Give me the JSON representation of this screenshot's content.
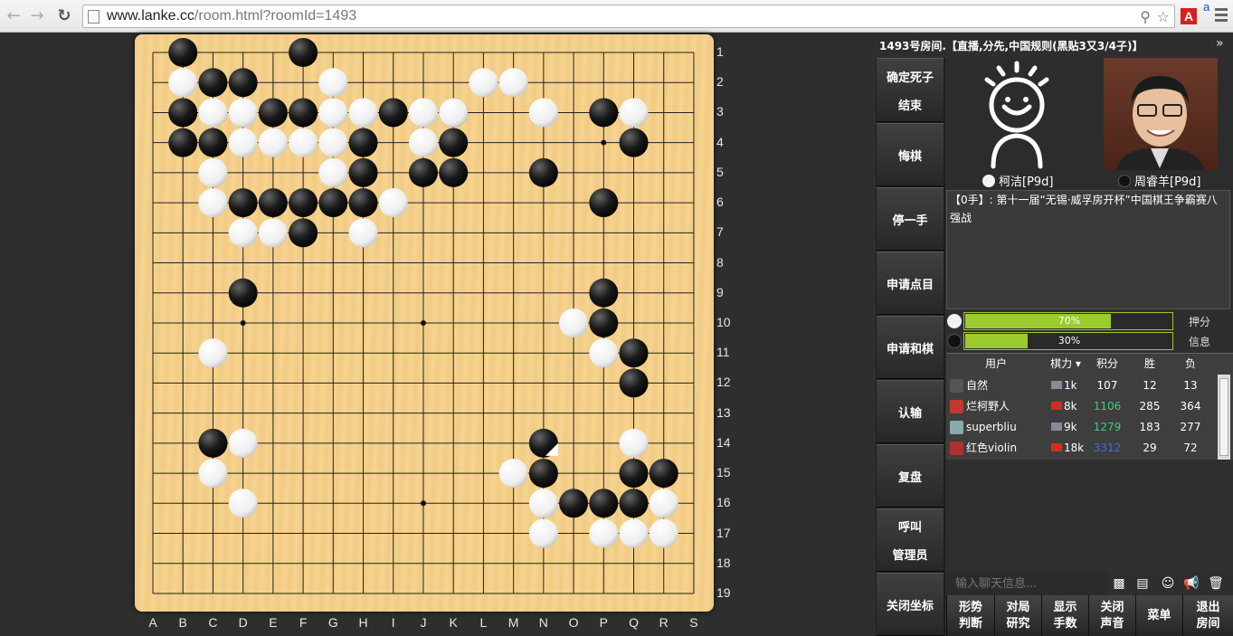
{
  "browser": {
    "url_host": "www.lanke.cc",
    "url_path": "/room.html?roomId=1493"
  },
  "board": {
    "col_labels": [
      "A",
      "B",
      "C",
      "D",
      "E",
      "F",
      "G",
      "H",
      "I",
      "J",
      "K",
      "L",
      "M",
      "N",
      "O",
      "P",
      "Q",
      "R",
      "S"
    ],
    "row_labels": [
      "1",
      "2",
      "3",
      "4",
      "5",
      "6",
      "7",
      "8",
      "9",
      "10",
      "11",
      "12",
      "13",
      "14",
      "15",
      "16",
      "17",
      "18",
      "19"
    ],
    "black_stones": [
      [
        2,
        1
      ],
      [
        6,
        1
      ],
      [
        2,
        3
      ],
      [
        3,
        2
      ],
      [
        4,
        2
      ],
      [
        2,
        4
      ],
      [
        3,
        4
      ],
      [
        5,
        3
      ],
      [
        6,
        3
      ],
      [
        9,
        3
      ],
      [
        8,
        4
      ],
      [
        8,
        5
      ],
      [
        11,
        3
      ],
      [
        11,
        4
      ],
      [
        10,
        5
      ],
      [
        11,
        5
      ],
      [
        4,
        6
      ],
      [
        5,
        6
      ],
      [
        6,
        6
      ],
      [
        7,
        6
      ],
      [
        8,
        6
      ],
      [
        6,
        7
      ],
      [
        14,
        5
      ],
      [
        16,
        3
      ],
      [
        17,
        4
      ],
      [
        16,
        6
      ],
      [
        4,
        9
      ],
      [
        16,
        9
      ],
      [
        16,
        10
      ],
      [
        17,
        11
      ],
      [
        17,
        12
      ],
      [
        3,
        14
      ],
      [
        14,
        14
      ],
      [
        14,
        15
      ],
      [
        17,
        15
      ],
      [
        18,
        15
      ],
      [
        15,
        16
      ],
      [
        16,
        16
      ],
      [
        17,
        16
      ]
    ],
    "white_stones": [
      [
        2,
        2
      ],
      [
        7,
        2
      ],
      [
        12,
        2
      ],
      [
        13,
        2
      ],
      [
        3,
        3
      ],
      [
        4,
        3
      ],
      [
        7,
        3
      ],
      [
        8,
        3
      ],
      [
        10,
        3
      ],
      [
        11,
        3
      ],
      [
        14,
        3
      ],
      [
        17,
        3
      ],
      [
        4,
        4
      ],
      [
        5,
        4
      ],
      [
        6,
        4
      ],
      [
        7,
        4
      ],
      [
        10,
        4
      ],
      [
        3,
        5
      ],
      [
        7,
        5
      ],
      [
        3,
        6
      ],
      [
        9,
        6
      ],
      [
        4,
        7
      ],
      [
        5,
        7
      ],
      [
        8,
        7
      ],
      [
        15,
        10
      ],
      [
        16,
        11
      ],
      [
        3,
        11
      ],
      [
        4,
        14
      ],
      [
        17,
        14
      ],
      [
        3,
        15
      ],
      [
        13,
        15
      ],
      [
        4,
        16
      ],
      [
        14,
        16
      ],
      [
        18,
        16
      ],
      [
        14,
        17
      ],
      [
        16,
        17
      ],
      [
        17,
        17
      ],
      [
        18,
        17
      ]
    ],
    "last_move": [
      14,
      14
    ]
  },
  "room_title": "1493号房间.【直播,分先,中国规则(黑贴3又3/4子)】",
  "side_menu": [
    {
      "lines": [
        "确定死子",
        "结束"
      ]
    },
    {
      "lines": [
        "悔棋"
      ]
    },
    {
      "lines": [
        "停一手"
      ]
    },
    {
      "lines": [
        "申请点目"
      ]
    },
    {
      "lines": [
        "申请和棋"
      ]
    },
    {
      "lines": [
        "认输"
      ]
    },
    {
      "lines": [
        "复盘"
      ]
    },
    {
      "lines": [
        "呼叫",
        "管理员"
      ]
    },
    {
      "lines": [
        "关闭坐标"
      ]
    }
  ],
  "players": {
    "white_name": "柯洁[P9d]",
    "black_name": "周睿羊[P9d]"
  },
  "comment": "【0手】: 第十一届“无锡·威孚房开杯”中国棋王争霸赛八强战",
  "bars": [
    {
      "label": "70%",
      "value": 0.7,
      "side": "押分"
    },
    {
      "label": "30%",
      "value": 0.3,
      "side": "信息"
    }
  ],
  "user_table": {
    "headers": [
      "用户",
      "棋力",
      "积分",
      "胜",
      "负"
    ],
    "rows": [
      {
        "name": "自然",
        "rank": "1k",
        "score": "107",
        "wins": "12",
        "losses": "13",
        "score_color": "#ffffff"
      },
      {
        "name": "烂柯野人",
        "rank": "8k",
        "score": "1106",
        "wins": "285",
        "losses": "364",
        "score_color": "#3ccf7a"
      },
      {
        "name": "superbliu",
        "rank": "9k",
        "score": "1279",
        "wins": "183",
        "losses": "277",
        "score_color": "#3ccf7a"
      },
      {
        "name": "红色violin",
        "rank": "18k",
        "score": "3312",
        "wins": "29",
        "losses": "72",
        "score_color": "#3b6fd6"
      }
    ]
  },
  "chat": {
    "placeholder": "输入聊天信息..."
  },
  "bottom_buttons": [
    {
      "lines": [
        "形势",
        "判断"
      ]
    },
    {
      "lines": [
        "对局",
        "研究"
      ]
    },
    {
      "lines": [
        "显示",
        "手数"
      ]
    },
    {
      "lines": [
        "关闭",
        "声音"
      ]
    },
    {
      "lines": [
        "菜单"
      ]
    },
    {
      "lines": [
        "退出",
        "房间"
      ]
    }
  ]
}
